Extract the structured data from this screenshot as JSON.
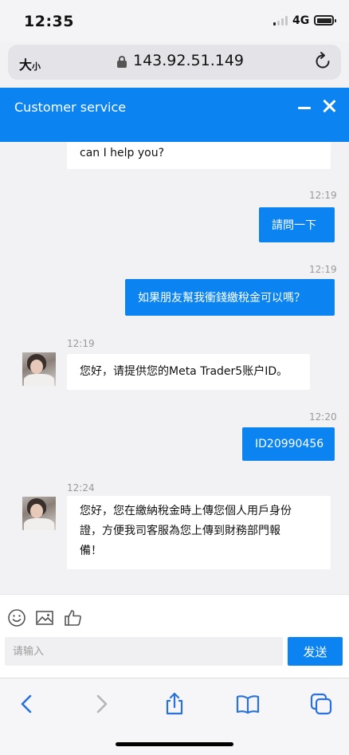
{
  "status_bar": {
    "time": "12:35",
    "network": "4G"
  },
  "address_bar": {
    "text_size_label": "大",
    "text_size_small": "小",
    "url": "143.92.51.149"
  },
  "chat_header": {
    "title": "Customer service"
  },
  "messages": [
    {
      "id": "m0",
      "sender": "agent",
      "text": "can I help you?"
    },
    {
      "id": "m1",
      "sender": "user",
      "time": "12:19",
      "text": "請問一下"
    },
    {
      "id": "m2",
      "sender": "user",
      "time": "12:19",
      "text": "如果朋友幫我衝錢繳稅金可以嗎？"
    },
    {
      "id": "m3",
      "sender": "agent",
      "time": "12:19",
      "text": "您好，请提供您的Meta Trader5账户ID。"
    },
    {
      "id": "m4",
      "sender": "user",
      "time": "12:20",
      "text": "ID20990456"
    },
    {
      "id": "m5",
      "sender": "agent",
      "time": "12:24",
      "text_lines": [
        "您好，您在繳納稅金時上傳您個人用戶身份",
        "證，方便我司客服為您上傳到財務部門報",
        "備！"
      ]
    }
  ],
  "composer": {
    "placeholder": "请输入",
    "send_label": "发送"
  },
  "toolbar_icons": [
    "emoji-icon",
    "image-icon",
    "thumbs-up-icon"
  ],
  "browser_nav_icons": [
    "back-icon",
    "forward-icon",
    "share-icon",
    "bookmarks-icon",
    "tabs-icon"
  ],
  "colors": {
    "accent": "#0b84f2",
    "background": "#f2f2f4",
    "bubble_in": "#ffffff",
    "browser_blue": "#2a72d8"
  }
}
